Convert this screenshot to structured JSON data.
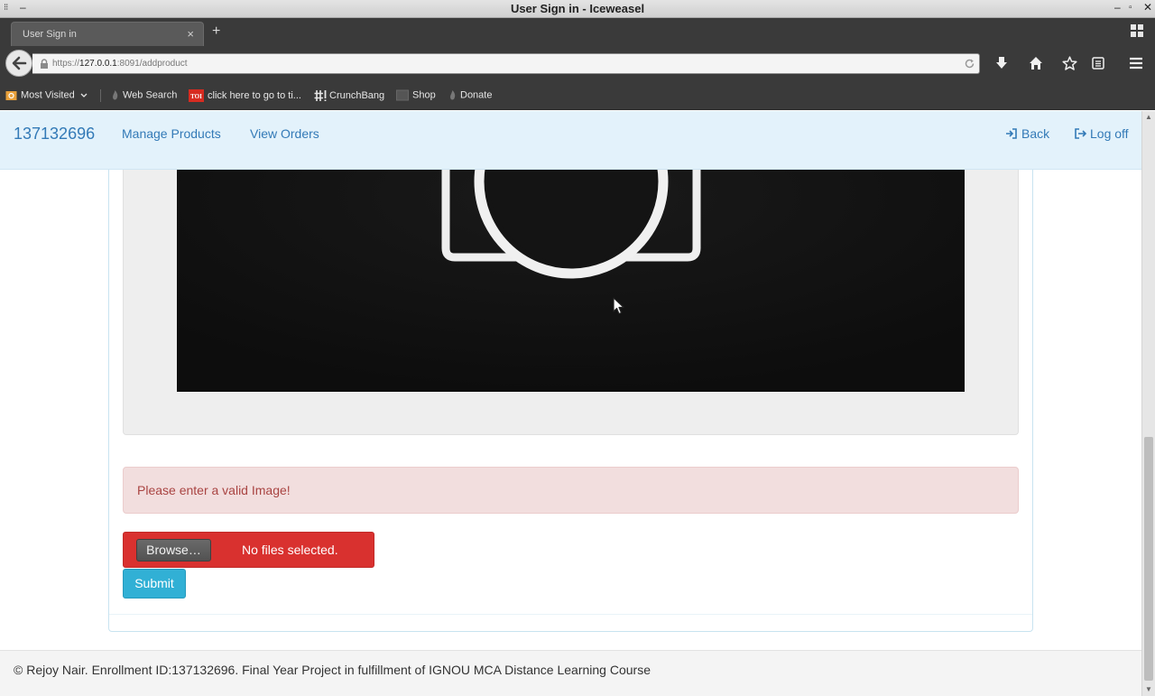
{
  "window": {
    "title": "User Sign in - Iceweasel"
  },
  "tabs": [
    {
      "label": "User Sign in",
      "close_glyph": "×"
    }
  ],
  "new_tab_glyph": "+",
  "url": {
    "prefix": "https://",
    "host": "127.0.0.1",
    "rest": ":8091/addproduct"
  },
  "bookmarks": {
    "most_visited": "Most Visited",
    "items": [
      {
        "label": "Web Search",
        "icon": "flame-icon"
      },
      {
        "label": "click here to go to ti...",
        "icon": "toi-icon"
      },
      {
        "label": "CrunchBang",
        "icon": "crunchbang-icon"
      },
      {
        "label": "Shop",
        "icon": "shop-icon"
      },
      {
        "label": "Donate",
        "icon": "flame-icon"
      }
    ]
  },
  "app_nav": {
    "brand": "137132696",
    "links": [
      "Manage Products",
      "View Orders"
    ],
    "back": "Back",
    "logoff": "Log off"
  },
  "alert": {
    "message": "Please enter a valid Image!"
  },
  "file_input": {
    "button": "Browse…",
    "status": "No files selected."
  },
  "submit": "Submit",
  "footer": "© Rejoy Nair. Enrollment ID:137132696. Final Year Project in fulfillment of IGNOU MCA Distance Learning Course",
  "colors": {
    "brand_blue": "#337ab7",
    "nav_bg": "#e3f2fb",
    "alert_bg": "#f2dede",
    "alert_text": "#a94442",
    "file_error_bg": "#d9312f",
    "submit_bg": "#31b0d5"
  }
}
